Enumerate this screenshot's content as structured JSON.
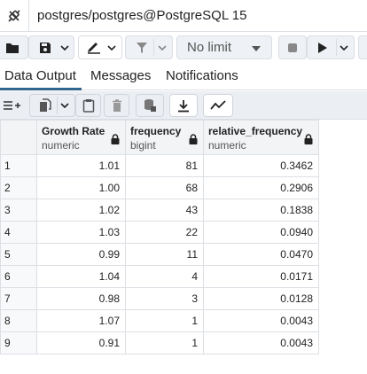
{
  "connection": {
    "title": "postgres/postgres@PostgreSQL 15"
  },
  "toolbar": {
    "limit_label": "No limit",
    "icons": [
      "open-folder-icon",
      "save-icon",
      "chevron-down-icon",
      "pen-icon",
      "filter-icon",
      "stop-icon",
      "play-icon"
    ]
  },
  "tabs": [
    {
      "label": "Data Output",
      "active": true
    },
    {
      "label": "Messages",
      "active": false
    },
    {
      "label": "Notifications",
      "active": false
    }
  ],
  "grid_toolbar": {
    "icons": [
      "add-row-icon",
      "copy-icon",
      "paste-icon",
      "delete-icon",
      "save-data-icon",
      "download-icon",
      "graph-icon"
    ]
  },
  "table": {
    "columns": [
      {
        "name": "Growth Rate",
        "type": "numeric"
      },
      {
        "name": "frequency",
        "type": "bigint"
      },
      {
        "name": "relative_frequency",
        "type": "numeric"
      }
    ],
    "rows": [
      {
        "n": "1",
        "rate": "1.01",
        "freq": "81",
        "rel": "0.3462"
      },
      {
        "n": "2",
        "rate": "1.00",
        "freq": "68",
        "rel": "0.2906"
      },
      {
        "n": "3",
        "rate": "1.02",
        "freq": "43",
        "rel": "0.1838"
      },
      {
        "n": "4",
        "rate": "1.03",
        "freq": "22",
        "rel": "0.0940"
      },
      {
        "n": "5",
        "rate": "0.99",
        "freq": "11",
        "rel": "0.0470"
      },
      {
        "n": "6",
        "rate": "1.04",
        "freq": "4",
        "rel": "0.0171"
      },
      {
        "n": "7",
        "rate": "0.98",
        "freq": "3",
        "rel": "0.0128"
      },
      {
        "n": "8",
        "rate": "1.07",
        "freq": "1",
        "rel": "0.0043"
      },
      {
        "n": "9",
        "rate": "0.91",
        "freq": "1",
        "rel": "0.0043"
      }
    ]
  },
  "colors": {
    "accent": "#326690",
    "border": "#dcdfe4",
    "toolbar_bg": "#ebeef3"
  }
}
